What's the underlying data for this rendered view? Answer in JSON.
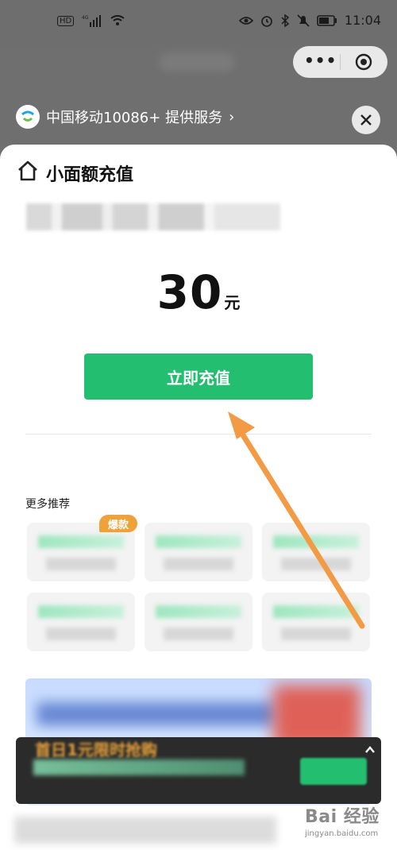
{
  "status_bar": {
    "time": "11:04",
    "icons": [
      "hd-icon",
      "signal-4g-icon",
      "wifi-icon",
      "eye-icon",
      "alarm-icon",
      "bluetooth-icon",
      "mute-icon",
      "battery-icon"
    ]
  },
  "topbar": {
    "provider": "中国移动10086+ 提供服务",
    "menu_label": "•••",
    "colors": {
      "capsule_bg": "#e9e9e9"
    }
  },
  "sheet": {
    "title": "小面额充值",
    "amount": "30",
    "amount_unit": "元",
    "recharge_label": "立即充值",
    "recommend_title": "更多推荐",
    "hot_badge": "爆款",
    "promo_partial": "首日1元限时抢购"
  },
  "watermark": {
    "main": "Bai 经验",
    "sub": "jingyan.baidu.com"
  },
  "colors": {
    "accent": "#23be6f",
    "badge": "#f0a23a",
    "arrow": "#f39a45"
  }
}
